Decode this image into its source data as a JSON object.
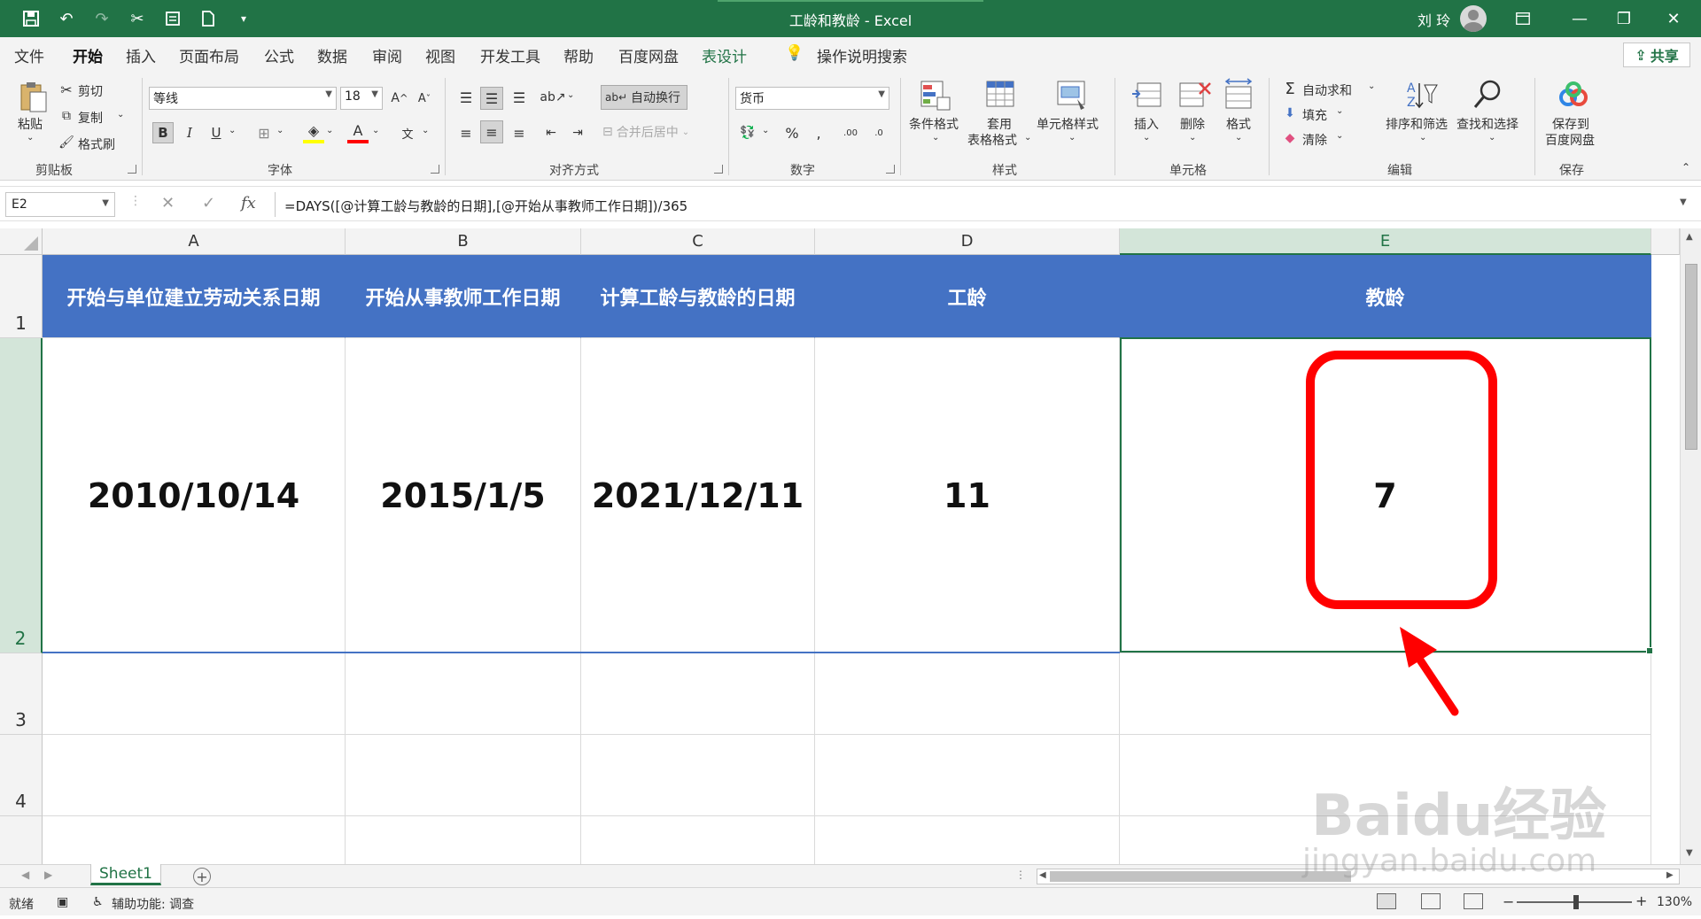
{
  "titlebar": {
    "title": "工龄和教龄  -  Excel",
    "user": "刘 玲",
    "qat_icons": [
      "save-icon",
      "undo-icon",
      "redo-icon",
      "cut-icon",
      "form-icon",
      "new-icon",
      "customize-icon"
    ]
  },
  "tabs": {
    "file": "文件",
    "home": "开始",
    "insert": "插入",
    "layout": "页面布局",
    "formulas": "公式",
    "data": "数据",
    "review": "审阅",
    "view": "视图",
    "developer": "开发工具",
    "help": "帮助",
    "baidu": "百度网盘",
    "table_design": "表设计",
    "tell_me": "操作说明搜索",
    "share": "共享"
  },
  "ribbon": {
    "clipboard": {
      "paste": "粘贴",
      "cut": "剪切",
      "copy": "复制",
      "format_painter": "格式刷",
      "label": "剪贴板"
    },
    "font": {
      "name": "等线",
      "size": "18",
      "label": "字体",
      "bold": "B",
      "italic": "I",
      "underline": "U"
    },
    "alignment": {
      "wrap": "自动换行",
      "merge": "合并后居中",
      "label": "对齐方式"
    },
    "number": {
      "format": "货币",
      "label": "数字"
    },
    "styles": {
      "conditional": "条件格式",
      "table_format_1": "套用",
      "table_format_2": "表格格式",
      "cell_styles": "单元格样式",
      "label": "样式"
    },
    "cells": {
      "insert": "插入",
      "delete": "删除",
      "format": "格式",
      "label": "单元格"
    },
    "editing": {
      "autosum": "自动求和",
      "fill": "填充",
      "clear": "清除",
      "sort": "排序和筛选",
      "find": "查找和选择",
      "label": "编辑"
    },
    "save": {
      "save_to_1": "保存到",
      "save_to_2": "百度网盘",
      "label": "保存"
    }
  },
  "formula_bar": {
    "name_box": "E2",
    "formula": "=DAYS([@计算工龄与教龄的日期],[@开始从事教师工作日期])/365"
  },
  "grid": {
    "columns": [
      "A",
      "B",
      "C",
      "D",
      "E"
    ],
    "rows": [
      "1",
      "2",
      "3",
      "4"
    ],
    "header_row": [
      "开始与单位建立劳动关系日期",
      "开始从事教师工作日期",
      "计算工龄与教龄的日期",
      "工龄",
      "教龄"
    ],
    "data_row": [
      "2010/10/14",
      "2015/1/5",
      "2021/12/11",
      "11",
      "7"
    ],
    "selected_cell": "E2",
    "header_color": "#4472c4",
    "highlight_color": "#ff0000"
  },
  "sheets": {
    "active": "Sheet1"
  },
  "statusbar": {
    "ready": "就绪",
    "accessibility": "辅助功能: 调查",
    "zoom": "130%"
  },
  "watermark": {
    "line1": "Baidu经验",
    "line2": "jingyan.baidu.com"
  },
  "colors": {
    "excel_green": "#217346"
  }
}
